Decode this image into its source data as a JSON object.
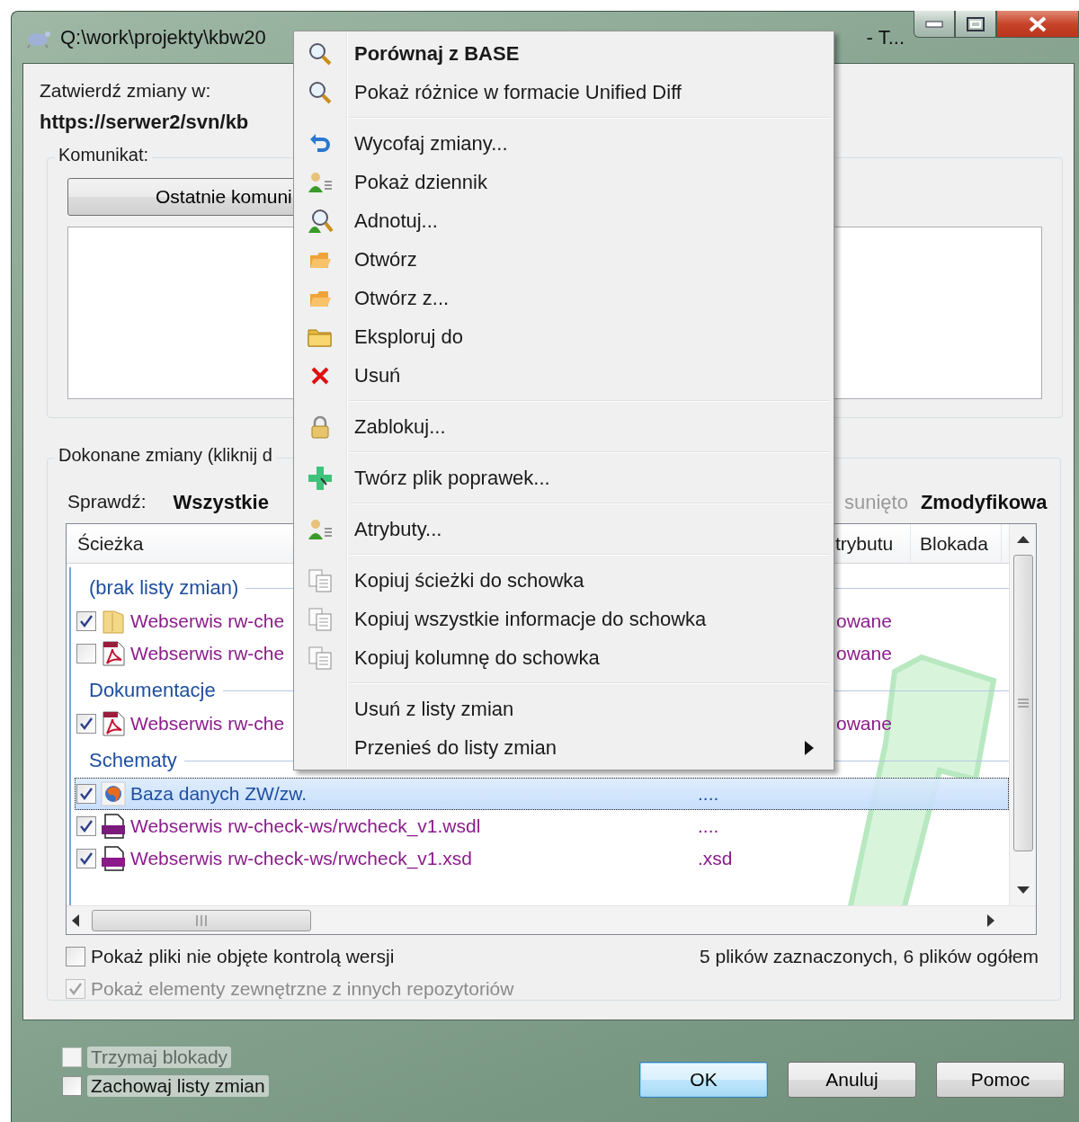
{
  "window": {
    "title_left": "Q:\\work\\projekty\\kbw20",
    "title_right": "- T..."
  },
  "commit_to": {
    "label": "Zatwierdź zmiany w:",
    "url": "https://serwer2/svn/kb"
  },
  "message_group": {
    "legend": "Komunikat:",
    "recent_button": "Ostatnie komuni"
  },
  "changes_group": {
    "legend": "Dokonane zmiany (kliknij d",
    "filter_label": "Sprawdź:",
    "filters": [
      {
        "label": "Wszystkie",
        "disabled": false
      },
      {
        "label": "sunięto",
        "disabled": true
      },
      {
        "label": "Zmodyfikowa",
        "disabled": false
      }
    ],
    "columns": [
      "Ścieżka",
      "trybutu",
      "Blokada"
    ],
    "rows": [
      {
        "kind": "group",
        "label": "(brak listy zmian)"
      },
      {
        "kind": "file",
        "checked": true,
        "selected": false,
        "path": "Webserwis rw-che",
        "status": "owane"
      },
      {
        "kind": "file",
        "checked": false,
        "selected": false,
        "path": "Webserwis rw-che",
        "status": "owane"
      },
      {
        "kind": "group",
        "label": "Dokumentacje"
      },
      {
        "kind": "file",
        "checked": true,
        "selected": false,
        "path": "Webserwis rw-che",
        "status": "owane"
      },
      {
        "kind": "group",
        "label": "Schematy"
      },
      {
        "kind": "file",
        "checked": true,
        "selected": true,
        "path": "Baza danych ZW/zw.",
        "ext": "...."
      },
      {
        "kind": "file",
        "checked": true,
        "selected": false,
        "path": "Webserwis rw-check-ws/rwcheck_v1.wsdl",
        "ext": "...."
      },
      {
        "kind": "file",
        "checked": true,
        "selected": false,
        "path": "Webserwis rw-check-ws/rwcheck_v1.xsd",
        "ext": ".xsd"
      }
    ],
    "options": [
      {
        "label": "Pokaż pliki nie objęte kontrolą wersji",
        "checked": false,
        "disabled": false
      },
      {
        "label": "Pokaż elementy zewnętrzne z innych repozytoriów",
        "checked": true,
        "disabled": true
      }
    ],
    "summary": "5 plików zaznaczonych, 6 plików ogółem"
  },
  "bottom_options": [
    {
      "label": "Trzymaj blokady",
      "checked": false,
      "disabled": true
    },
    {
      "label": "Zachowaj listy zmian",
      "checked": false,
      "disabled": false
    }
  ],
  "buttons": [
    {
      "label": "OK",
      "default": true
    },
    {
      "label": "Anuluj",
      "default": false
    },
    {
      "label": "Pomoc",
      "default": false
    }
  ],
  "context_menu": {
    "groups": [
      {
        "items": [
          {
            "label": "Porównaj z BASE",
            "default": true,
            "submenu": false
          },
          {
            "label": "Pokaż różnice w formacie Unified Diff",
            "default": false,
            "submenu": false
          }
        ]
      },
      {
        "items": [
          {
            "label": "Wycofaj zmiany...",
            "default": false,
            "submenu": false
          },
          {
            "label": "Pokaż dziennik",
            "default": false,
            "submenu": false
          },
          {
            "label": "Adnotuj...",
            "default": false,
            "submenu": false
          },
          {
            "label": "Otwórz",
            "default": false,
            "submenu": false
          },
          {
            "label": "Otwórz z...",
            "default": false,
            "submenu": false
          },
          {
            "label": "Eksploruj do",
            "default": false,
            "submenu": false
          },
          {
            "label": "Usuń",
            "default": false,
            "submenu": false
          }
        ]
      },
      {
        "items": [
          {
            "label": "Zablokuj...",
            "default": false,
            "submenu": false
          }
        ]
      },
      {
        "items": [
          {
            "label": "Twórz plik poprawek...",
            "default": false,
            "submenu": false
          }
        ]
      },
      {
        "items": [
          {
            "label": "Atrybuty...",
            "default": false,
            "submenu": false
          }
        ]
      },
      {
        "items": [
          {
            "label": "Kopiuj ścieżki do schowka",
            "default": false,
            "submenu": false
          },
          {
            "label": "Kopiuj wszystkie informacje do schowka",
            "default": false,
            "submenu": false
          },
          {
            "label": "Kopiuj kolumnę do schowka",
            "default": false,
            "submenu": false
          }
        ]
      },
      {
        "items": [
          {
            "label": "Usuń z listy zmian",
            "default": false,
            "submenu": false
          },
          {
            "label": "Przenieś do listy zmian",
            "default": false,
            "submenu": true
          }
        ]
      }
    ]
  }
}
